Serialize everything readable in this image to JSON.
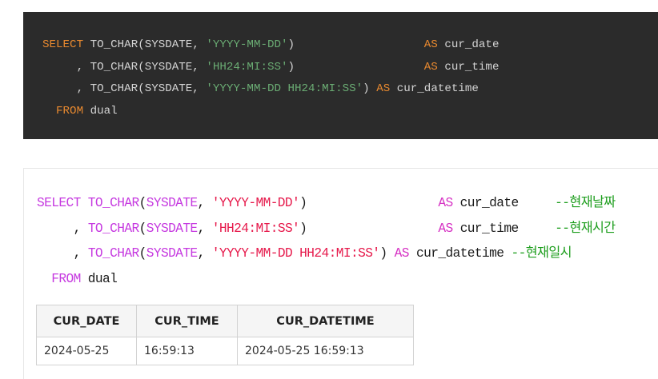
{
  "dark_code": {
    "lines": [
      [
        {
          "cls": "dk-kw",
          "text": "SELECT"
        },
        {
          "cls": "dk-fn",
          "text": " TO_CHAR(SYSDATE, "
        },
        {
          "cls": "dk-str",
          "text": "'YYYY-MM-DD'"
        },
        {
          "cls": "dk-fn",
          "text": ")                   "
        },
        {
          "cls": "dk-kw",
          "text": "AS"
        },
        {
          "cls": "dk-id",
          "text": " cur_date"
        }
      ],
      [
        {
          "cls": "dk-fn",
          "text": "     , TO_CHAR(SYSDATE, "
        },
        {
          "cls": "dk-str",
          "text": "'HH24:MI:SS'"
        },
        {
          "cls": "dk-fn",
          "text": ")                   "
        },
        {
          "cls": "dk-kw",
          "text": "AS"
        },
        {
          "cls": "dk-id",
          "text": " cur_time"
        }
      ],
      [
        {
          "cls": "dk-fn",
          "text": "     , TO_CHAR(SYSDATE, "
        },
        {
          "cls": "dk-str",
          "text": "'YYYY-MM-DD HH24:MI:SS'"
        },
        {
          "cls": "dk-fn",
          "text": ") "
        },
        {
          "cls": "dk-kw",
          "text": "AS"
        },
        {
          "cls": "dk-id",
          "text": " cur_datetime"
        }
      ],
      [
        {
          "cls": "dk-kw",
          "text": "  FROM"
        },
        {
          "cls": "dk-id",
          "text": " dual"
        }
      ]
    ]
  },
  "light_code": {
    "lines": [
      [
        {
          "cls": "lt-kw",
          "text": "SELECT"
        },
        {
          "cls": "lt-fn",
          "text": " TO_CHAR"
        },
        {
          "cls": "lt-id",
          "text": "("
        },
        {
          "cls": "lt-fn",
          "text": "SYSDATE"
        },
        {
          "cls": "lt-id",
          "text": ", "
        },
        {
          "cls": "lt-str",
          "text": "'YYYY-MM-DD'"
        },
        {
          "cls": "lt-id",
          "text": ")                  "
        },
        {
          "cls": "lt-kw2",
          "text": "AS"
        },
        {
          "cls": "lt-id",
          "text": " cur_date     "
        },
        {
          "cls": "lt-cm",
          "text": "--현재날짜"
        }
      ],
      [
        {
          "cls": "lt-id",
          "text": "     , "
        },
        {
          "cls": "lt-fn",
          "text": "TO_CHAR"
        },
        {
          "cls": "lt-id",
          "text": "("
        },
        {
          "cls": "lt-fn",
          "text": "SYSDATE"
        },
        {
          "cls": "lt-id",
          "text": ", "
        },
        {
          "cls": "lt-str",
          "text": "'HH24:MI:SS'"
        },
        {
          "cls": "lt-id",
          "text": ")                  "
        },
        {
          "cls": "lt-kw2",
          "text": "AS"
        },
        {
          "cls": "lt-id",
          "text": " cur_time     "
        },
        {
          "cls": "lt-cm",
          "text": "--현재시간"
        }
      ],
      [
        {
          "cls": "lt-id",
          "text": "     , "
        },
        {
          "cls": "lt-fn",
          "text": "TO_CHAR"
        },
        {
          "cls": "lt-id",
          "text": "("
        },
        {
          "cls": "lt-fn",
          "text": "SYSDATE"
        },
        {
          "cls": "lt-id",
          "text": ", "
        },
        {
          "cls": "lt-str",
          "text": "'YYYY-MM-DD HH24:MI:SS'"
        },
        {
          "cls": "lt-id",
          "text": ") "
        },
        {
          "cls": "lt-kw2",
          "text": "AS"
        },
        {
          "cls": "lt-id",
          "text": " cur_datetime "
        },
        {
          "cls": "lt-cm",
          "text": "--현재일시"
        }
      ],
      [
        {
          "cls": "lt-kw",
          "text": "  FROM"
        },
        {
          "cls": "lt-id",
          "text": " dual"
        }
      ]
    ]
  },
  "result_table": {
    "headers": [
      "CUR_DATE",
      "CUR_TIME",
      "CUR_DATETIME"
    ],
    "rows": [
      [
        "2024-05-25",
        "16:59:13",
        "2024-05-25 16:59:13"
      ]
    ]
  },
  "colors": {
    "dark_bg": "#2b2b2b",
    "dark_keyword": "#e8892f",
    "dark_string": "#6aab73",
    "light_keyword": "#c63ae0",
    "light_string": "#e6194b",
    "light_comment": "#1e9e1e"
  }
}
